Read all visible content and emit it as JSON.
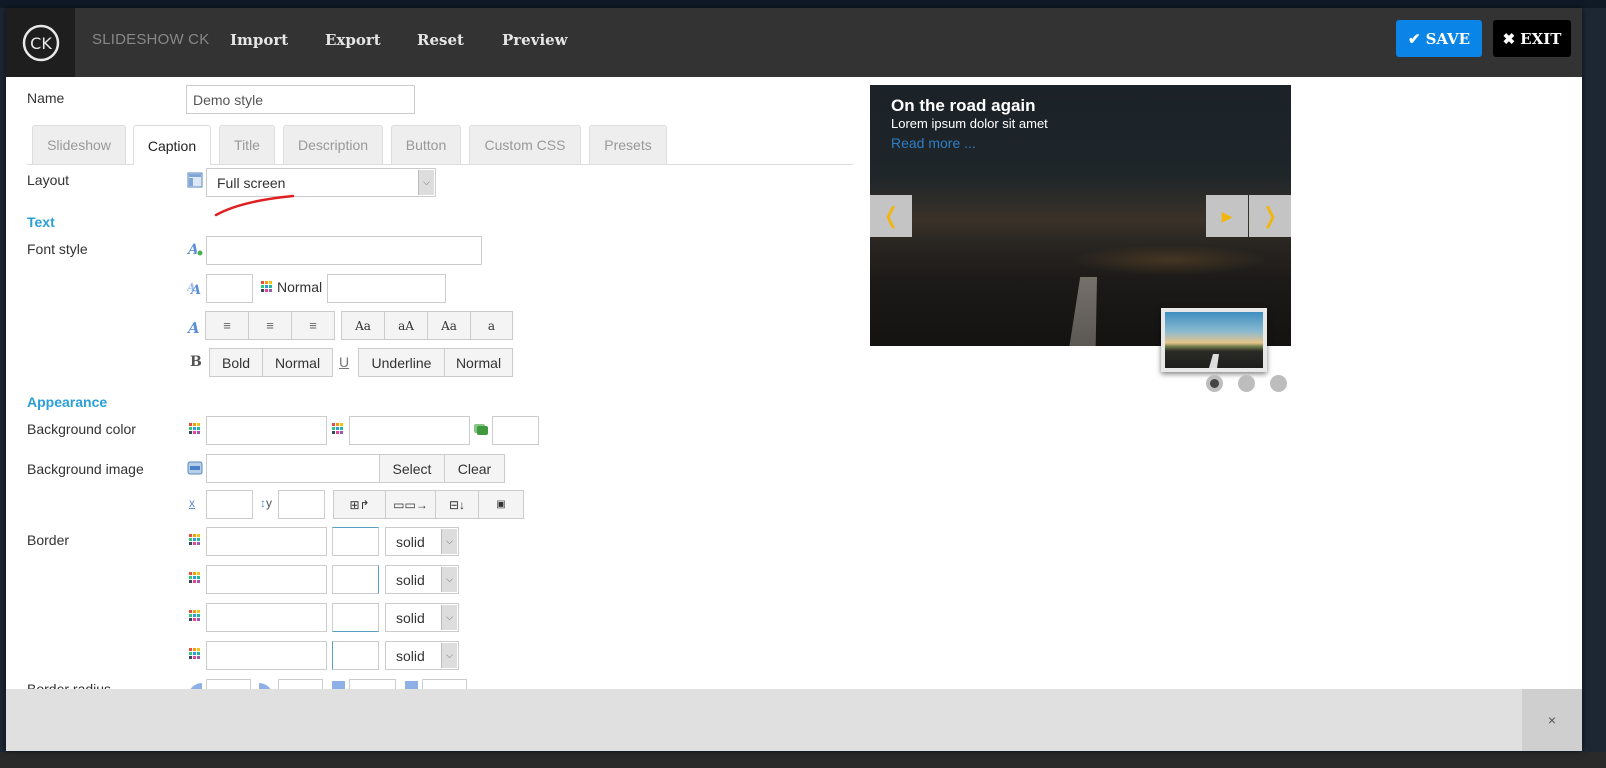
{
  "header": {
    "app_title": "SLIDESHOW CK",
    "logo_text": "CK",
    "menu": [
      "Import",
      "Export",
      "Reset",
      "Preview"
    ],
    "save_label": "SAVE",
    "exit_label": "EXIT"
  },
  "form": {
    "name_label": "Name",
    "name_value": "Demo style",
    "tabs": [
      "Slideshow",
      "Caption",
      "Title",
      "Description",
      "Button",
      "Custom CSS",
      "Presets"
    ],
    "active_tab": "Caption",
    "layout_label": "Layout",
    "layout_value": "Full screen",
    "text_section": "Text",
    "font_style_label": "Font style",
    "font_weight_text": "Normal",
    "text_align_buttons": [
      "align-left",
      "align-center",
      "align-right"
    ],
    "text_transform_buttons": [
      "Aa-capitalize",
      "aA-uppercase",
      "Aa",
      "a"
    ],
    "text_transform_labels": [
      "Aa",
      "aA",
      "Aa",
      "a"
    ],
    "bold_buttons": [
      "Bold",
      "Normal"
    ],
    "underline_buttons": [
      "Underline",
      "Normal"
    ],
    "appearance_section": "Appearance",
    "bg_color_label": "Background color",
    "bg_image_label": "Background image",
    "select_label": "Select",
    "clear_label": "Clear",
    "bg_x_label": "x",
    "bg_y_label": "y",
    "border_label": "Border",
    "border_styles": [
      "solid",
      "solid",
      "solid",
      "solid"
    ],
    "border_radius_label": "Border radius"
  },
  "preview": {
    "caption_title": "On the road again",
    "caption_desc": "Lorem ipsum dolor sit amet",
    "caption_link": "Read more ...",
    "accent_color": "#f2b50c",
    "slide_count": 3,
    "active_slide": 1
  },
  "footer": {
    "close_label": "×"
  }
}
